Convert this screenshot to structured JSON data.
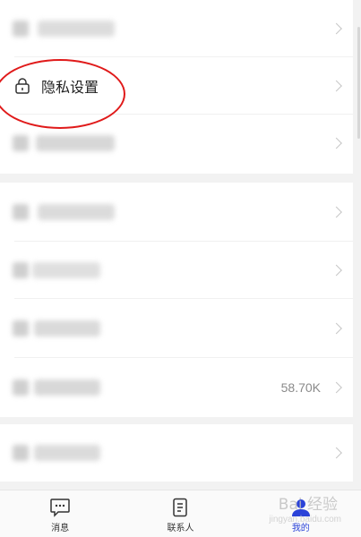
{
  "settings": {
    "privacy_label": "隐私设置",
    "storage_value": "58.70K"
  },
  "tabs": [
    {
      "label": "消息",
      "icon": "message-icon"
    },
    {
      "label": "联系人",
      "icon": "contacts-icon"
    },
    {
      "label": "我的",
      "icon": "profile-icon"
    }
  ],
  "colors": {
    "annotation": "#e01a1a",
    "active_tab": "#2b43d8"
  },
  "watermark": {
    "text": "Bai 经验",
    "sub": "jingyan.baidu.com"
  }
}
